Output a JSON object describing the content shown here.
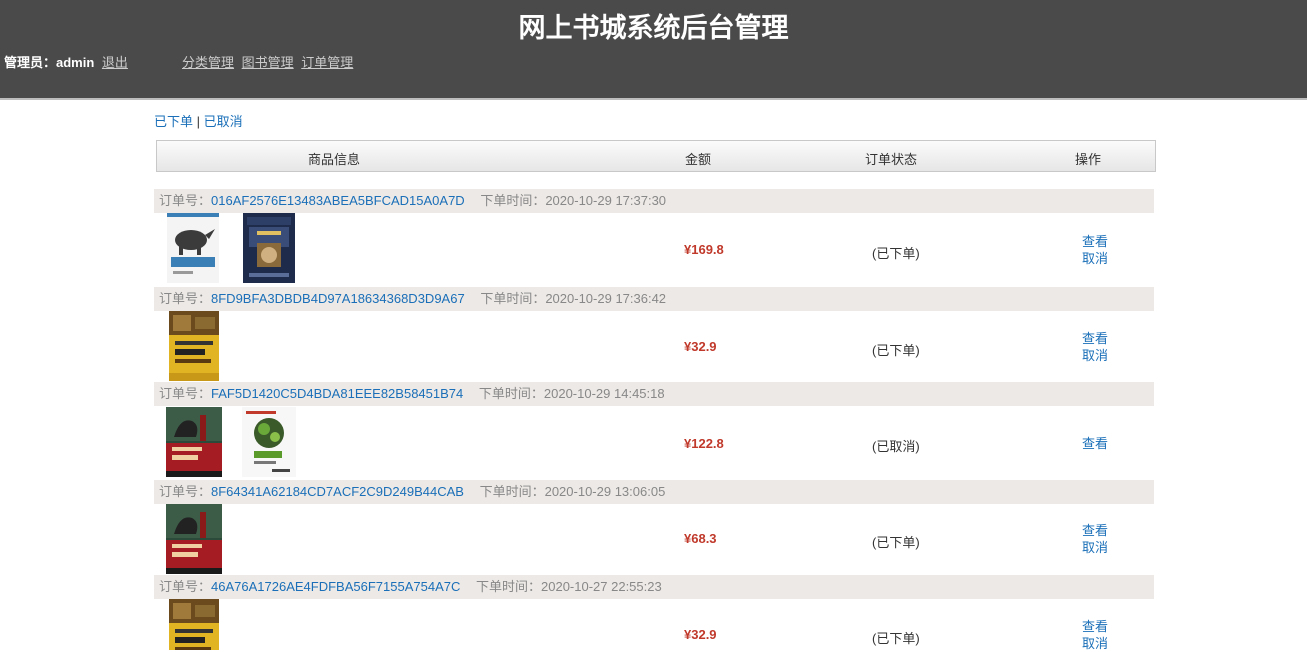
{
  "header": {
    "title": "网上书城系统后台管理",
    "admin_label": "管理员：admin",
    "logout": "退出",
    "nav": [
      "分类管理",
      "图书管理",
      "订单管理"
    ]
  },
  "filter": {
    "placed": "已下单",
    "sep": " | ",
    "cancelled": "已取消"
  },
  "table_header": {
    "goods": "商品信息",
    "amount": "金额",
    "status": "订单状态",
    "ops": "操作"
  },
  "labels": {
    "order_no": "订单号：",
    "order_time": "下单时间："
  },
  "orders": [
    {
      "id": "016AF2576E13483ABEA5BFCAD15A0A7D",
      "time": "2020-10-29 17:37:30",
      "amount": "¥169.8",
      "status": "(已下单)",
      "ops": [
        "查看",
        "取消"
      ],
      "books": [
        "javascript-rhino-cover",
        "java-thinking-cover"
      ]
    },
    {
      "id": "8FD9BFA3DBDB4D97A18634368D3D9A67",
      "time": "2020-10-29 17:36:42",
      "amount": "¥32.9",
      "status": "(已下单)",
      "ops": [
        "查看",
        "取消"
      ],
      "books": [
        "html-css-yellow-cover"
      ]
    },
    {
      "id": "FAF5D1420C5D4BDA81EEE82B58451B74",
      "time": "2020-10-29 14:45:18",
      "amount": "¥122.8",
      "status": "(已取消)",
      "ops": [
        "查看"
      ],
      "books": [
        "javascript-advanced-red-cover",
        "nodejs-white-cover"
      ]
    },
    {
      "id": "8F64341A62184CD7ACF2C9D249B44CAB",
      "time": "2020-10-29 13:06:05",
      "amount": "¥68.3",
      "status": "(已下单)",
      "ops": [
        "查看",
        "取消"
      ],
      "books": [
        "javascript-advanced-red-cover"
      ]
    },
    {
      "id": "46A76A1726AE4FDFBA56F7155A754A7C",
      "time": "2020-10-27 22:55:23",
      "amount": "¥32.9",
      "status": "(已下单)",
      "ops": [
        "查看",
        "取消"
      ],
      "books": [
        "html-css-yellow-cover"
      ]
    }
  ],
  "colors": {
    "header_bg": "#4a4a4a",
    "link": "#1a6fb8",
    "amount": "#c0392b",
    "order_head_bg": "#ede9e6"
  }
}
